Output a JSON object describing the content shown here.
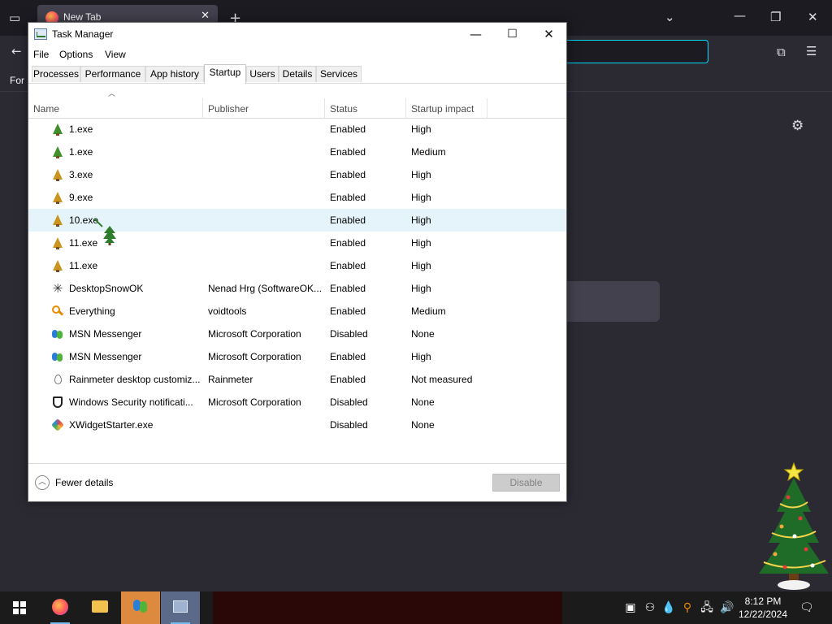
{
  "browser": {
    "tab_title": "New Tab",
    "bookmark_text": "For"
  },
  "task_manager": {
    "title": "Task Manager",
    "menu": [
      "File",
      "Options",
      "View"
    ],
    "tabs": [
      "Processes",
      "Performance",
      "App history",
      "Startup",
      "Users",
      "Details",
      "Services"
    ],
    "active_tab": "Startup",
    "columns": {
      "name": "Name",
      "publisher": "Publisher",
      "status": "Status",
      "impact": "Startup impact"
    },
    "rows": [
      {
        "name": "1.exe",
        "publisher": "",
        "status": "Enabled",
        "impact": "High",
        "icon": "tree-icon"
      },
      {
        "name": "1.exe",
        "publisher": "",
        "status": "Enabled",
        "impact": "Medium",
        "icon": "tree-icon"
      },
      {
        "name": "3.exe",
        "publisher": "",
        "status": "Enabled",
        "impact": "High",
        "icon": "tree-gold-icon"
      },
      {
        "name": "9.exe",
        "publisher": "",
        "status": "Enabled",
        "impact": "High",
        "icon": "tree-gold-icon"
      },
      {
        "name": "10.exe",
        "publisher": "",
        "status": "Enabled",
        "impact": "High",
        "icon": "tree-gold-icon"
      },
      {
        "name": "11.exe",
        "publisher": "",
        "status": "Enabled",
        "impact": "High",
        "icon": "tree-gold-icon"
      },
      {
        "name": "11.exe",
        "publisher": "",
        "status": "Enabled",
        "impact": "High",
        "icon": "tree-gold-icon"
      },
      {
        "name": "DesktopSnowOK",
        "publisher": "Nenad Hrg (SoftwareOK...",
        "status": "Enabled",
        "impact": "High",
        "icon": "snowflake-icon"
      },
      {
        "name": "Everything",
        "publisher": "voidtools",
        "status": "Enabled",
        "impact": "Medium",
        "icon": "magnifier-icon"
      },
      {
        "name": "MSN Messenger",
        "publisher": "Microsoft Corporation",
        "status": "Disabled",
        "impact": "None",
        "icon": "msn-icon"
      },
      {
        "name": "MSN Messenger",
        "publisher": "Microsoft Corporation",
        "status": "Enabled",
        "impact": "High",
        "icon": "msn-icon"
      },
      {
        "name": "Rainmeter desktop customiz...",
        "publisher": "Rainmeter",
        "status": "Enabled",
        "impact": "Not measured",
        "icon": "raindrop-icon"
      },
      {
        "name": "Windows Security notificati...",
        "publisher": "Microsoft Corporation",
        "status": "Disabled",
        "impact": "None",
        "icon": "shield-icon"
      },
      {
        "name": "XWidgetStarter.exe",
        "publisher": "",
        "status": "Disabled",
        "impact": "None",
        "icon": "xwidget-icon"
      }
    ],
    "hovered_row": 4,
    "footer": {
      "fewer_details": "Fewer details",
      "disable": "Disable"
    }
  },
  "taskbar": {
    "time": "8:12 PM",
    "date": "12/22/2024"
  }
}
